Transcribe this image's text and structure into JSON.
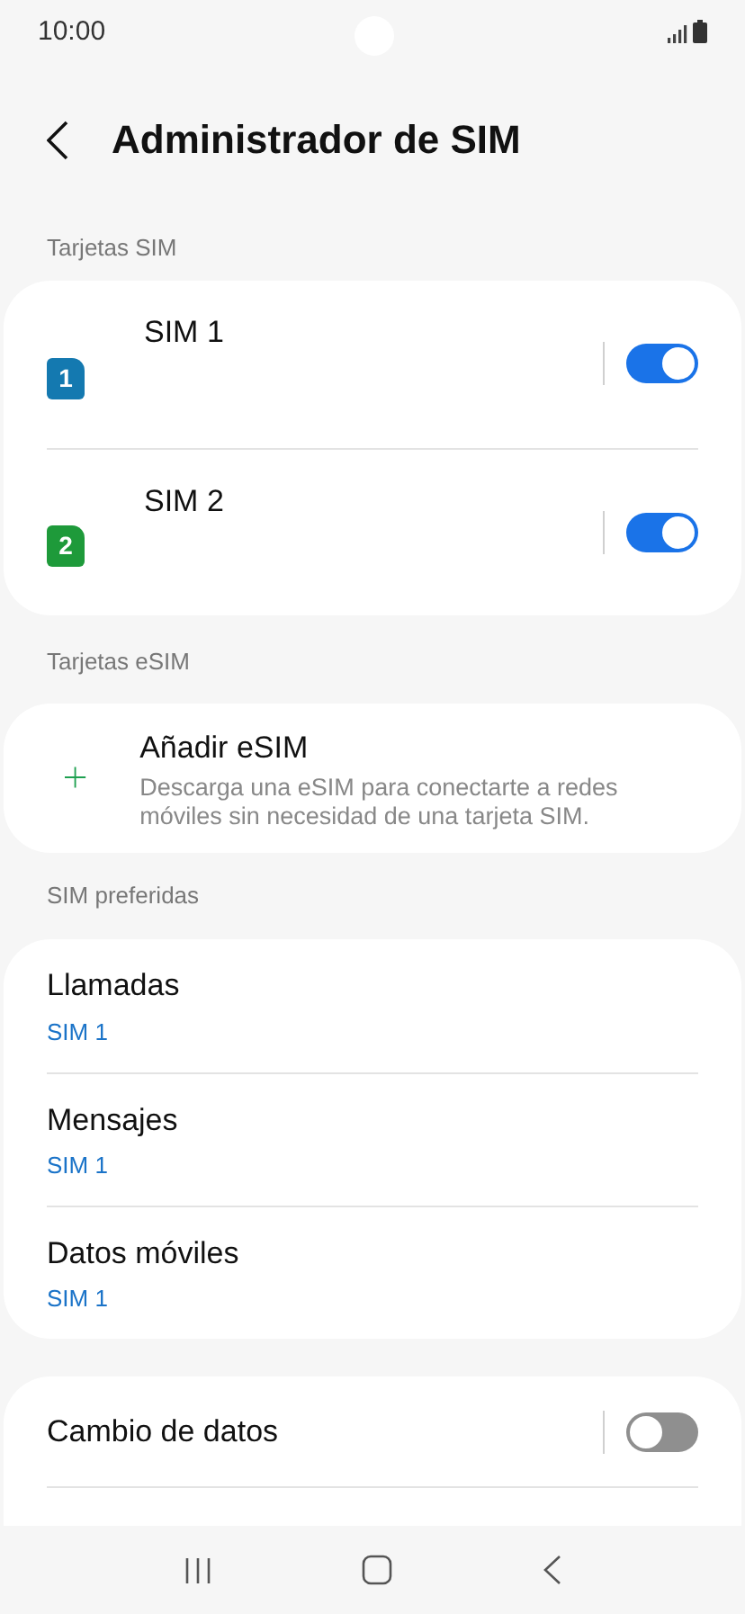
{
  "status_bar": {
    "time": "10:00"
  },
  "header": {
    "title": "Administrador de SIM"
  },
  "sim_section": {
    "label": "Tarjetas SIM",
    "cards": [
      {
        "badge": "1",
        "name": "SIM 1",
        "color": "#1479b0",
        "on": true
      },
      {
        "badge": "2",
        "name": "SIM 2",
        "color": "#1e9a3a",
        "on": true
      }
    ]
  },
  "esim_section": {
    "label": "Tarjetas eSIM",
    "title": "Añadir eSIM",
    "description": "Descarga una eSIM para conectarte a redes móviles sin necesidad de una tarjeta SIM."
  },
  "preferred_section": {
    "label": "SIM preferidas",
    "items": [
      {
        "title": "Llamadas",
        "value": "SIM 1"
      },
      {
        "title": "Mensajes",
        "value": "SIM 1"
      },
      {
        "title": "Datos móviles",
        "value": "SIM 1"
      }
    ]
  },
  "data_switch": {
    "title": "Cambio de datos",
    "on": false
  }
}
